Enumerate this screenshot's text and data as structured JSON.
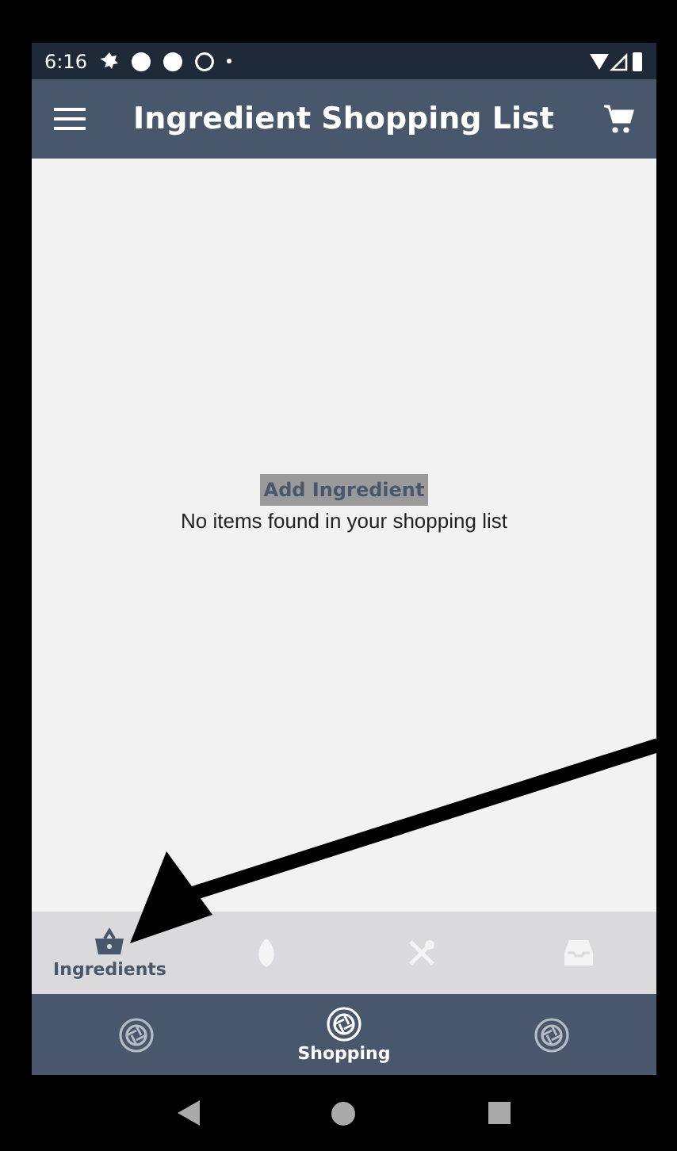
{
  "status_bar": {
    "time": "6:16"
  },
  "app_bar": {
    "title": "Ingredient Shopping List"
  },
  "content": {
    "add_button": "Add Ingredient",
    "empty_message": "No items found in your shopping list"
  },
  "tabs": [
    {
      "kind": "basket",
      "label": "Ingredients",
      "selected": true
    },
    {
      "kind": "leaf",
      "selected": false
    },
    {
      "kind": "utensils",
      "selected": false
    },
    {
      "kind": "inbox",
      "selected": false
    }
  ],
  "bottom_nav": [
    {
      "selected": false
    },
    {
      "label": "Shopping",
      "selected": true
    },
    {
      "selected": false
    }
  ]
}
